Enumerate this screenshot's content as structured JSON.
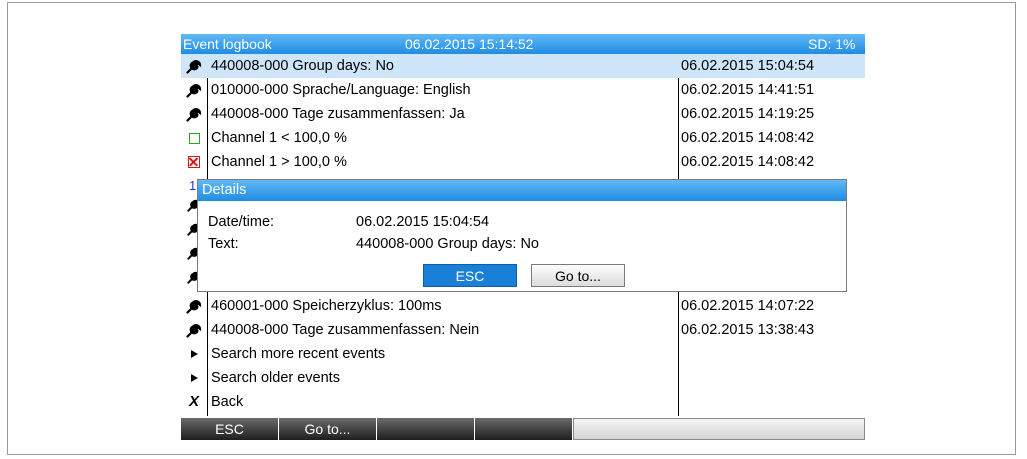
{
  "header": {
    "title": "Event logbook",
    "datetime": "06.02.2015 15:14:52",
    "sd": "SD: 1%"
  },
  "rows_top": [
    {
      "icon": "wrench-icon",
      "text": "440008-000 Group days: No",
      "time": "06.02.2015 15:04:54",
      "selected": true
    },
    {
      "icon": "wrench-icon",
      "text": "010000-000 Sprache/Language: English",
      "time": "06.02.2015 14:41:51"
    },
    {
      "icon": "wrench-icon",
      "text": "440008-000 Tage zusammenfassen: Ja",
      "time": "06.02.2015 14:19:25"
    },
    {
      "icon": "green-square-icon",
      "text": "Channel 1 < 100,0 %",
      "time": "06.02.2015 14:08:42"
    },
    {
      "icon": "red-x-square-icon",
      "text": "Channel 1 > 100,0 %",
      "time": "06.02.2015 14:08:42"
    }
  ],
  "hidden_row_marker": "1",
  "rows_bottom": [
    {
      "icon": "wrench-icon",
      "text": "460001-000 Speicherzyklus: 100ms",
      "time": "06.02.2015 14:07:22"
    },
    {
      "icon": "wrench-icon",
      "text": "440008-000 Tage zusammenfassen: Nein",
      "time": "06.02.2015 13:38:43"
    },
    {
      "icon": "triangle-icon",
      "text": "Search more recent events",
      "time": ""
    },
    {
      "icon": "triangle-icon",
      "text": "Search older events",
      "time": ""
    },
    {
      "icon": "back-x-icon",
      "text": "Back",
      "time": ""
    }
  ],
  "dialog": {
    "title": "Details",
    "date_label": "Date/time:",
    "date_value": "06.02.2015 15:04:54",
    "text_label": "Text:",
    "text_value": "440008-000 Group days: No",
    "esc_label": "ESC",
    "goto_label": "Go to..."
  },
  "softkeys": [
    "ESC",
    "Go to...",
    "",
    "",
    ""
  ],
  "colors": {
    "accent": "#1f8ce3",
    "selection": "#cfe6fa"
  }
}
